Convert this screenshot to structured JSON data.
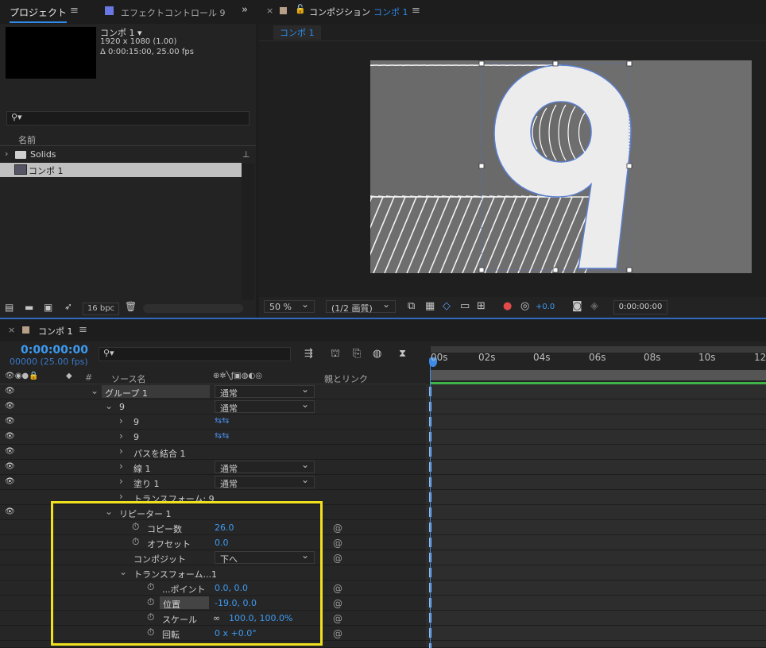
{
  "project_panel": {
    "tab_label": "プロジェクト",
    "effects_tab_label": "エフェクトコントロール 9",
    "comp_name": "コンポ 1 ▾",
    "comp_resolution": "1920 x 1080 (1.00)",
    "comp_duration": "Δ 0:00:15:00, 25.00 fps",
    "search_placeholder": "",
    "column_name": "名前",
    "items": [
      {
        "label": "Solids",
        "icon": "folder-icon"
      },
      {
        "label": "コンポ 1",
        "icon": "composition-icon"
      }
    ],
    "bpc": "16 bpc"
  },
  "comp_panel": {
    "tab_prefix": "コンポジション",
    "tab_comp": "コンポ 1",
    "breadcrumb": "コンポ 1",
    "zoom": "50 %",
    "resolution": "(1/2 画質)",
    "exposure": "+0.0",
    "timecode": "0:00:00:00"
  },
  "timeline": {
    "tab_label": "コンポ 1",
    "timecode": "0:00:00:00",
    "frames": "00000 (25.00 fps)",
    "search_placeholder": "",
    "col_hash": "#",
    "col_source": "ソース名",
    "col_parent": "親とリンク",
    "ruler": [
      "00s",
      "02s",
      "04s",
      "06s",
      "08s",
      "10s",
      "12"
    ],
    "rows": {
      "group": "グループ 1",
      "group_mode": "通常",
      "nine": "9",
      "nine_mode": "通常",
      "path1": "9",
      "path2": "9",
      "merge": "パスを結合 1",
      "stroke": "線 1",
      "stroke_mode": "通常",
      "fill": "塗り 1",
      "fill_mode": "通常",
      "transform9": "トランスフォーム: 9",
      "repeater": "リピーター 1",
      "copies_label": "コピー数",
      "copies_value": "26.0",
      "offset_label": "オフセット",
      "offset_value": "0.0",
      "composite_label": "コンポジット",
      "composite_value": "下へ",
      "transform_label": "トランスフォーム...1",
      "anchor_label": "...ポイント",
      "anchor_value": "0.0, 0.0",
      "position_label": "位置",
      "position_value": "-19.0, 0.0",
      "scale_label": "スケール",
      "scale_value": "100.0, 100.0%",
      "rotation_label": "回転",
      "rotation_value": "0 x +0.0°"
    }
  },
  "colors": {
    "accent": "#2d8ceb",
    "highlight_box": "#f0e11f",
    "work_area": "#3fb24a"
  }
}
